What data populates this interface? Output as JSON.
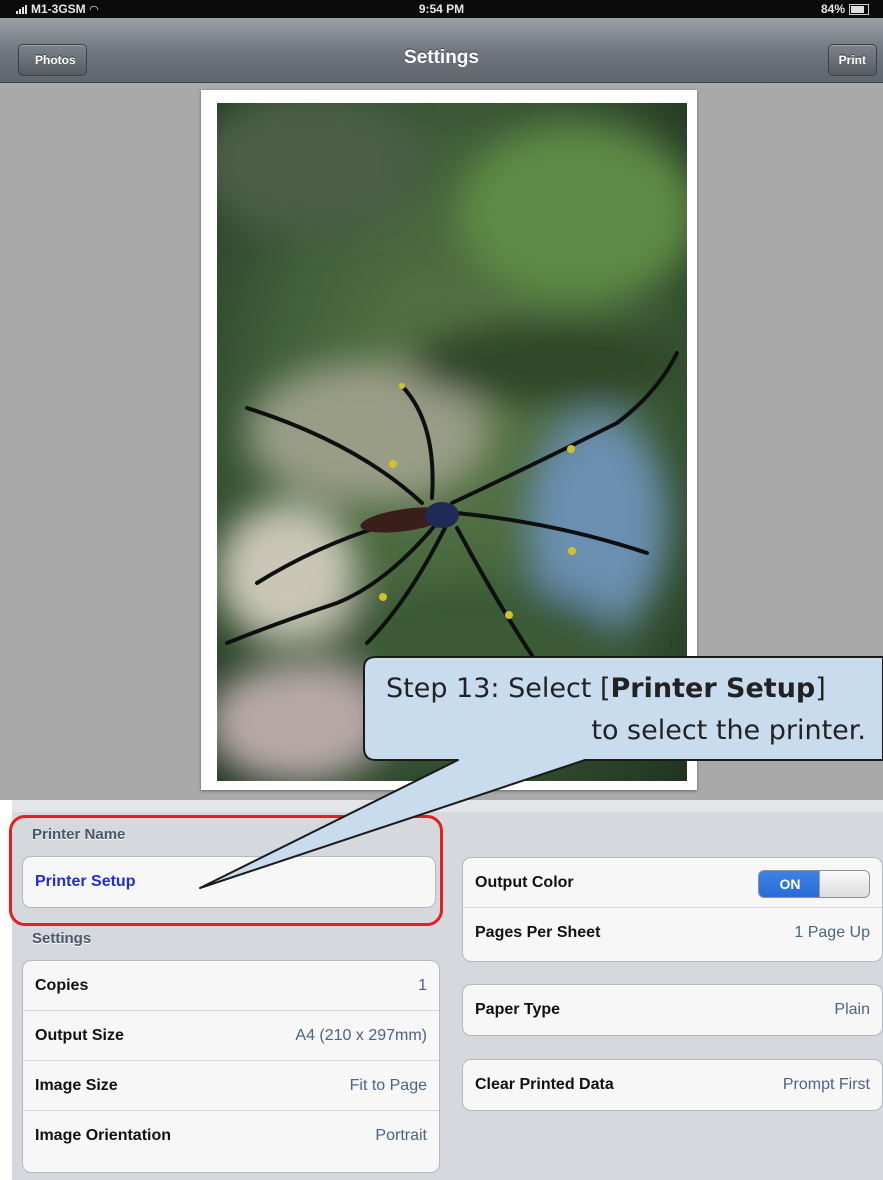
{
  "status_bar": {
    "carrier": "M1-3GSM",
    "time": "9:54 PM",
    "battery": "84%"
  },
  "nav": {
    "title": "Settings",
    "back_label": "Photos",
    "print_label": "Print"
  },
  "printer_section": {
    "header": "Printer Name",
    "printer_setup_label": "Printer Setup"
  },
  "settings_section": {
    "header": "Settings",
    "rows": [
      {
        "label": "Copies",
        "value": "1"
      },
      {
        "label": "Output Size",
        "value": "A4 (210 x 297mm)"
      },
      {
        "label": "Image Size",
        "value": "Fit to Page"
      },
      {
        "label": "Image Orientation",
        "value": "Portrait"
      }
    ]
  },
  "right_settings": {
    "output_color": {
      "label": "Output Color",
      "toggle": "ON"
    },
    "pages_per_sheet": {
      "label": "Pages Per Sheet",
      "value": "1 Page Up"
    },
    "paper_type": {
      "label": "Paper Type",
      "value": "Plain"
    },
    "clear_printed_data": {
      "label": "Clear Printed Data",
      "value": "Prompt First"
    }
  },
  "callout": {
    "prefix": "Step 13: Select [",
    "bold": "Printer Setup",
    "suffix": "]",
    "line2": "to select the printer."
  },
  "colors": {
    "highlight": "#e51e1e",
    "callout_fill": "#c8dced",
    "toggle_on": "#2a6bd5",
    "link_blue": "#1f2ecc"
  }
}
